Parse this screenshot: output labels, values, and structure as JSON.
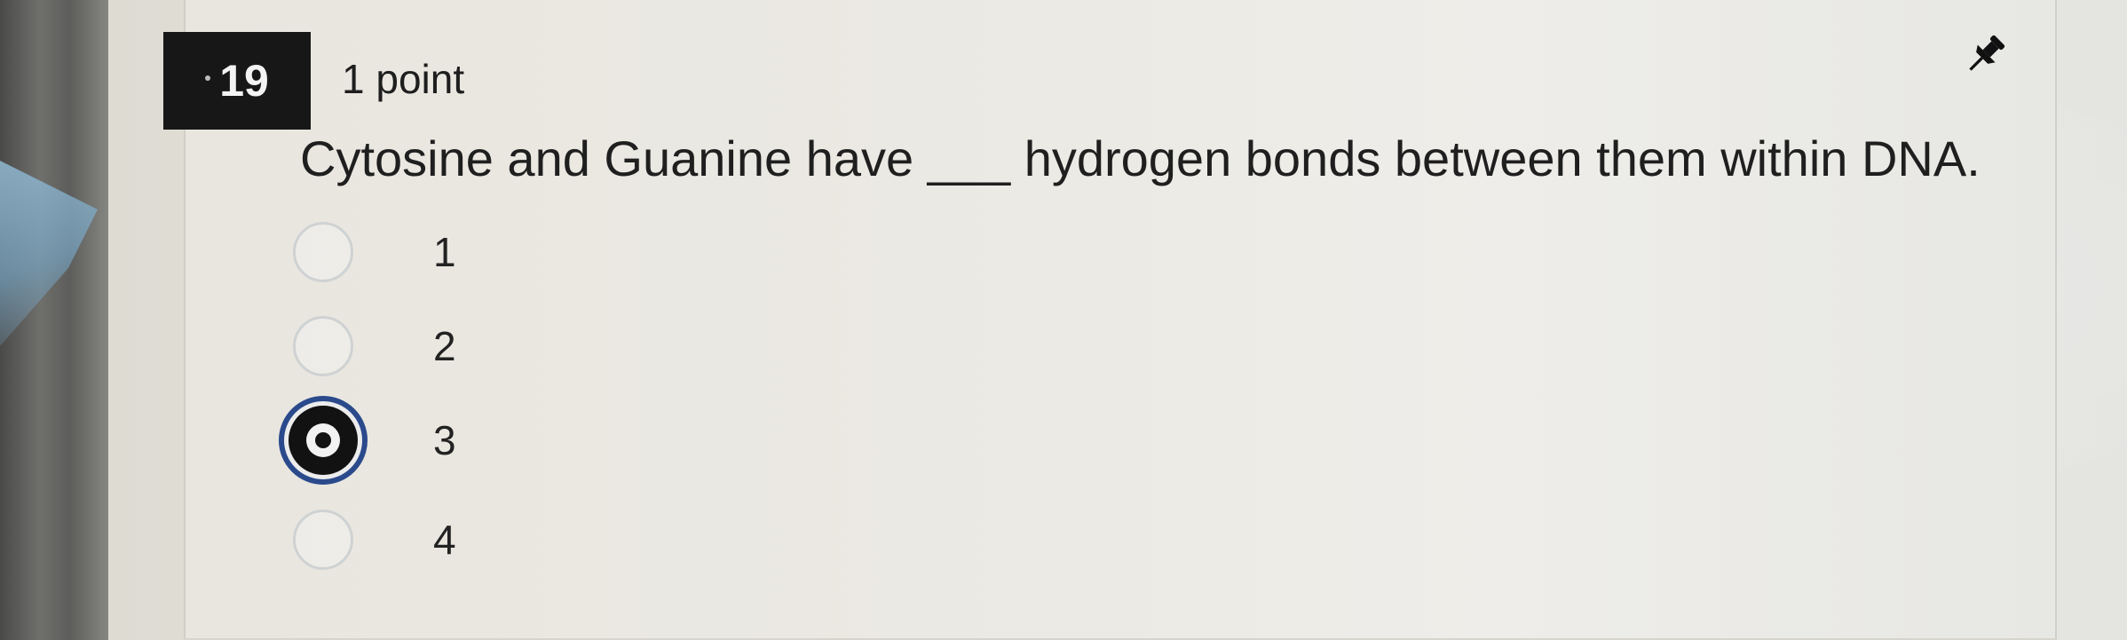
{
  "question": {
    "number": "19",
    "points": "1 point",
    "text": "Cytosine and Guanine have ___ hydrogen bonds between them within DNA.",
    "options": [
      {
        "label": "1",
        "selected": false
      },
      {
        "label": "2",
        "selected": false
      },
      {
        "label": "3",
        "selected": true
      },
      {
        "label": "4",
        "selected": false
      }
    ]
  },
  "icons": {
    "pin": "pin-icon"
  },
  "colors": {
    "number_badge_bg": "#171717",
    "selected_outline": "#2a4a8c"
  }
}
